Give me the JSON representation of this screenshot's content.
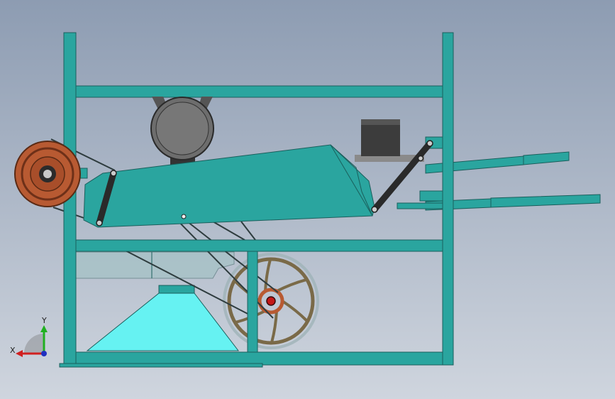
{
  "view": {
    "background_top": "#8d9cb2",
    "background_bottom": "#cfd5de"
  },
  "colors": {
    "frame": "#2aa59f",
    "frame_edge": "#1a5f5c",
    "hopper": "#66f2f2",
    "chute": "#a9c2c8",
    "pulley": "#b85a32",
    "wheel_rim": "#7a6a48",
    "motor": "#6d6d6d",
    "gearbox": "#3c3c3c"
  },
  "triad": {
    "x_label": "X",
    "y_label": "Y",
    "x_color": "#d02020",
    "y_color": "#20b020",
    "z_color": "#2030c0"
  }
}
